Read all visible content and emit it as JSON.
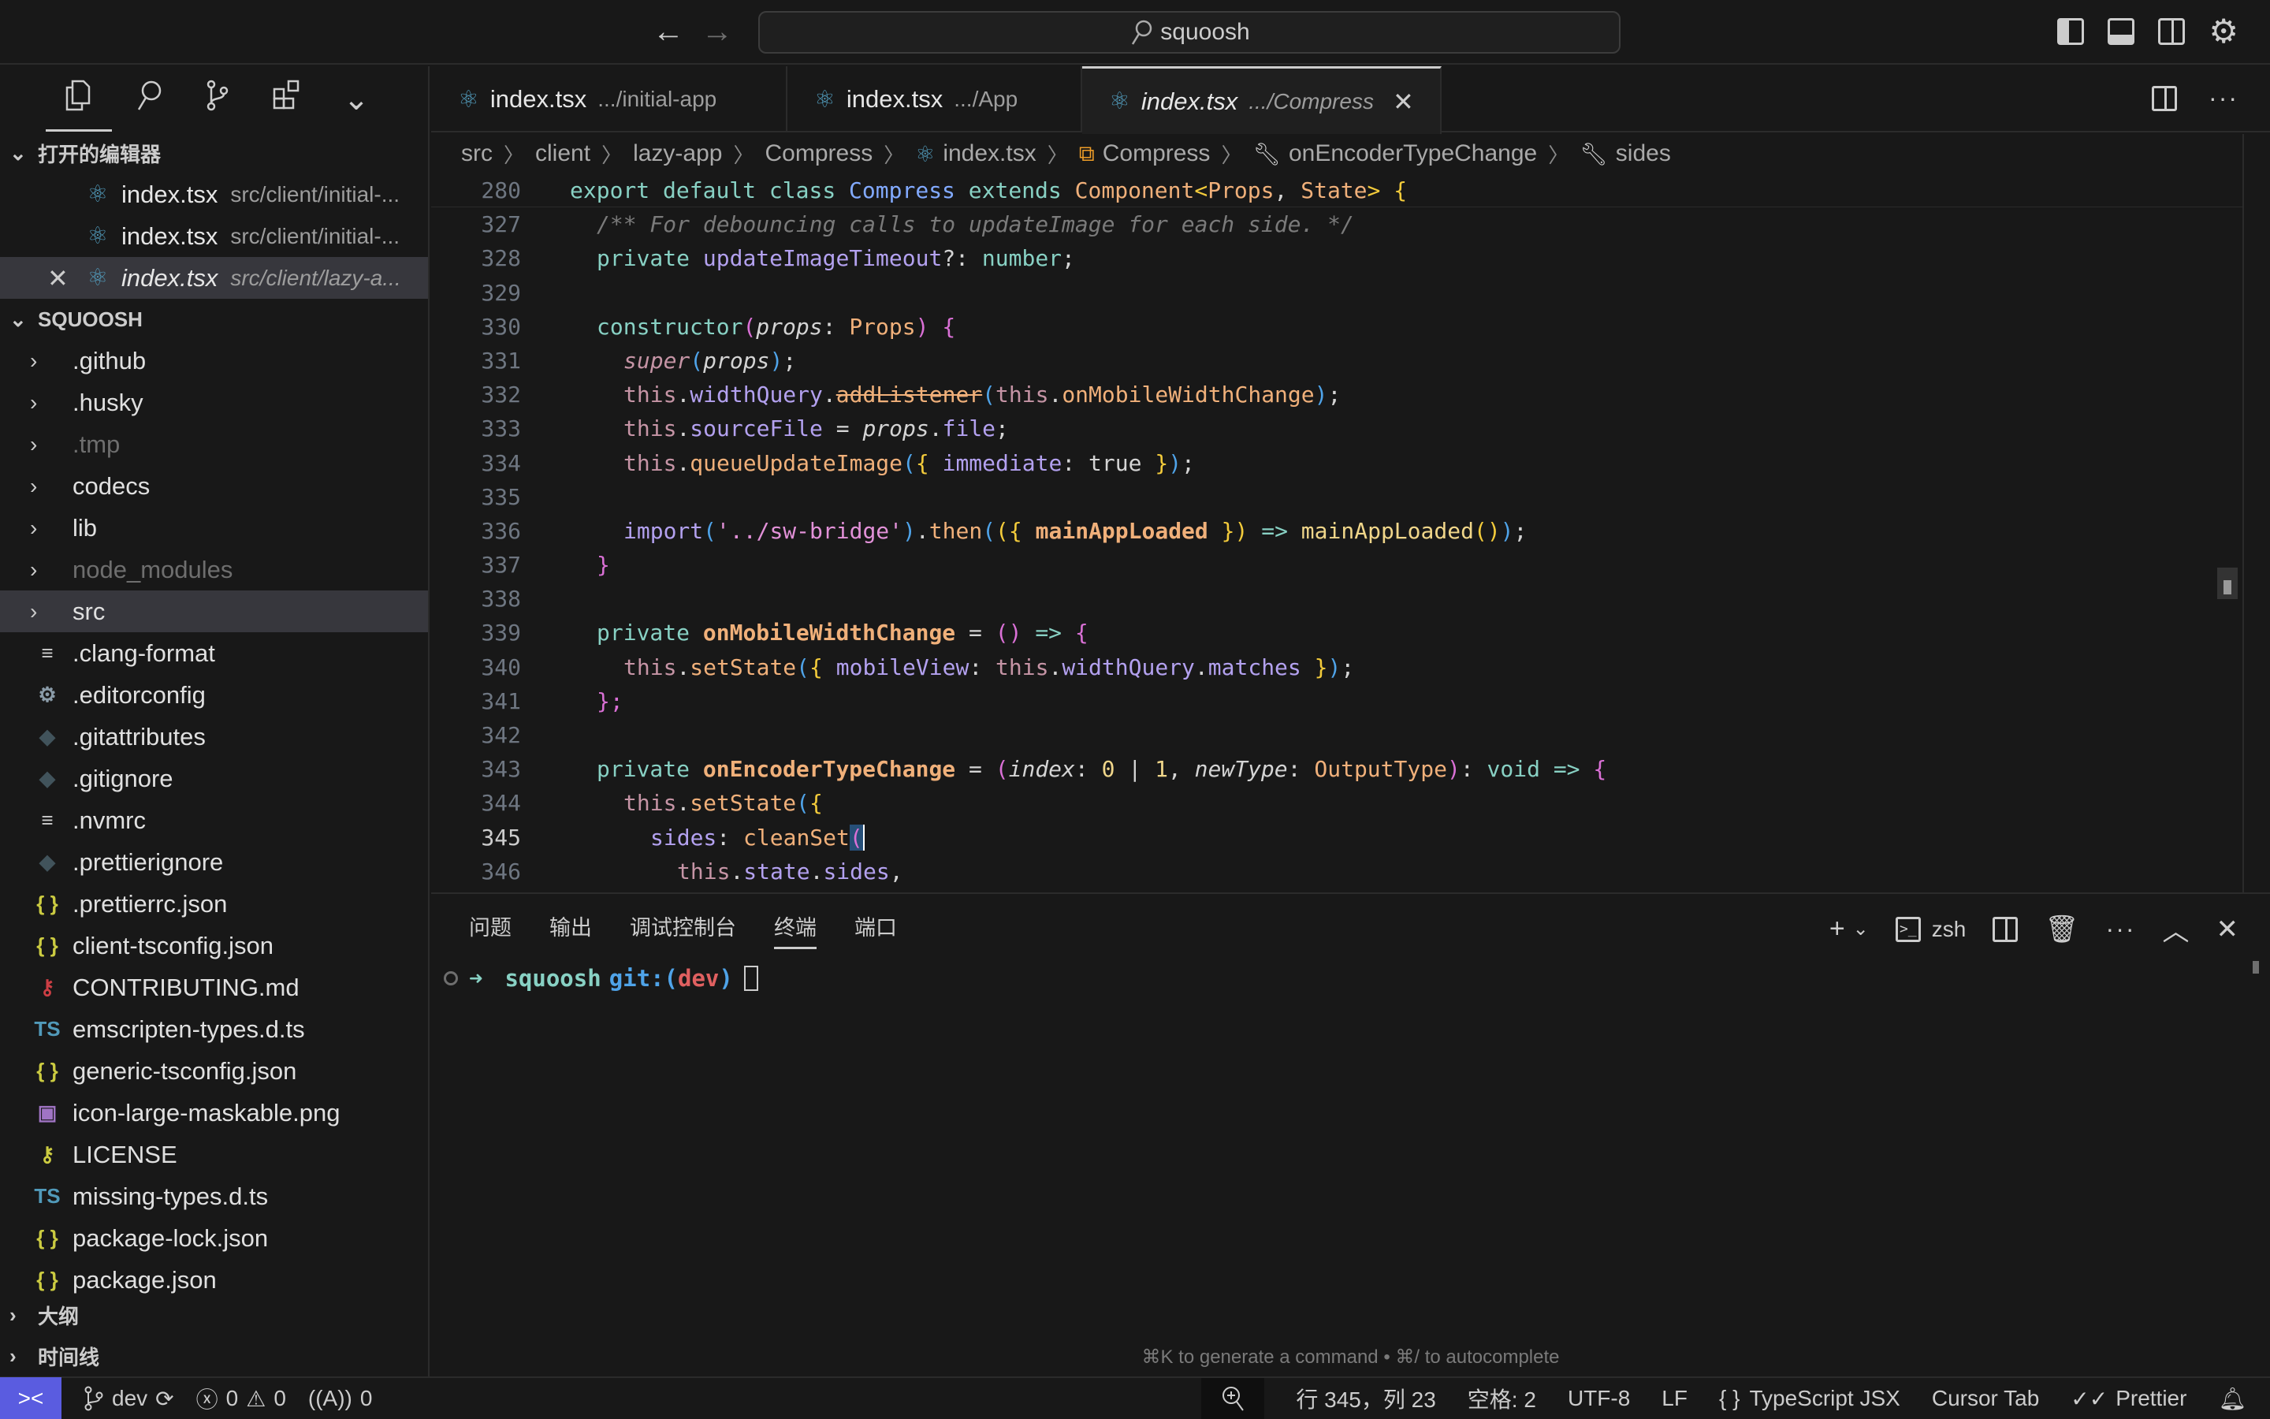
{
  "titlebar": {
    "search_text": "squoosh",
    "icons": [
      "arrow-left-icon",
      "arrow-right-icon",
      "toggle-primary-sidebar-icon",
      "toggle-panel-icon",
      "toggle-secondary-sidebar-icon",
      "settings-gear-icon"
    ]
  },
  "sidebar": {
    "activity_icons": [
      "explorer-icon",
      "search-icon",
      "source-control-icon",
      "extensions-icon",
      "chevron-down-icon"
    ],
    "open_editors_title": "打开的编辑器",
    "open_editors": [
      {
        "name": "index.tsx",
        "path": "src/client/initial-...",
        "active": false
      },
      {
        "name": "index.tsx",
        "path": "src/client/initial-...",
        "active": false
      },
      {
        "name": "index.tsx",
        "path": "src/client/lazy-a...",
        "active": true
      }
    ],
    "project_title": "SQUOOSH",
    "tree": [
      {
        "name": ".github",
        "type": "folder"
      },
      {
        "name": ".husky",
        "type": "folder"
      },
      {
        "name": ".tmp",
        "type": "folder",
        "dim": true
      },
      {
        "name": "codecs",
        "type": "folder"
      },
      {
        "name": "lib",
        "type": "folder"
      },
      {
        "name": "node_modules",
        "type": "folder",
        "dim": true
      },
      {
        "name": "src",
        "type": "folder",
        "selected": true
      },
      {
        "name": ".clang-format",
        "type": "text"
      },
      {
        "name": ".editorconfig",
        "type": "config"
      },
      {
        "name": ".gitattributes",
        "type": "git"
      },
      {
        "name": ".gitignore",
        "type": "git"
      },
      {
        "name": ".nvmrc",
        "type": "text"
      },
      {
        "name": ".prettierignore",
        "type": "git"
      },
      {
        "name": ".prettierrc.json",
        "type": "json"
      },
      {
        "name": "client-tsconfig.json",
        "type": "json"
      },
      {
        "name": "CONTRIBUTING.md",
        "type": "contrib"
      },
      {
        "name": "emscripten-types.d.ts",
        "type": "ts"
      },
      {
        "name": "generic-tsconfig.json",
        "type": "json"
      },
      {
        "name": "icon-large-maskable.png",
        "type": "image"
      },
      {
        "name": "LICENSE",
        "type": "license"
      },
      {
        "name": "missing-types.d.ts",
        "type": "ts"
      },
      {
        "name": "package-lock.json",
        "type": "json"
      },
      {
        "name": "package.json",
        "type": "json"
      }
    ],
    "outline_title": "大纲",
    "timeline_title": "时间线"
  },
  "tabs": [
    {
      "name": "index.tsx",
      "path": ".../initial-app",
      "active": false
    },
    {
      "name": "index.tsx",
      "path": ".../App",
      "active": false
    },
    {
      "name": "index.tsx",
      "path": ".../Compress",
      "active": true
    }
  ],
  "breadcrumb": [
    "src",
    "client",
    "lazy-app",
    "Compress",
    "index.tsx",
    "Compress",
    "onEncoderTypeChange",
    "sides"
  ],
  "editor": {
    "current_line": 345,
    "lines": [
      {
        "n": "280",
        "sticky": true
      },
      {
        "n": "327"
      },
      {
        "n": "328"
      },
      {
        "n": "329"
      },
      {
        "n": "330"
      },
      {
        "n": "331"
      },
      {
        "n": "332"
      },
      {
        "n": "333"
      },
      {
        "n": "334"
      },
      {
        "n": "335"
      },
      {
        "n": "336"
      },
      {
        "n": "337"
      },
      {
        "n": "338"
      },
      {
        "n": "339"
      },
      {
        "n": "340"
      },
      {
        "n": "341"
      },
      {
        "n": "342"
      },
      {
        "n": "343"
      },
      {
        "n": "344"
      },
      {
        "n": "345"
      },
      {
        "n": "346"
      }
    ],
    "code": {
      "l280": [
        "export",
        "default",
        "class",
        "Compress",
        "extends",
        "Component",
        "<",
        "Props",
        ", ",
        "State",
        ">",
        "{"
      ],
      "l327": "/** For debouncing calls to updateImage for each side. */",
      "l328": [
        "private",
        "updateImageTimeout",
        "?: ",
        "number",
        ";"
      ],
      "l330": [
        "constructor",
        "(",
        "props",
        ": ",
        "Props",
        ")",
        "{"
      ],
      "l331": [
        "super",
        "(",
        "props",
        ")",
        ";"
      ],
      "l332": [
        "this",
        ".",
        "widthQuery",
        ".",
        "addListener",
        "(",
        "this",
        ".",
        "onMobileWidthChange",
        ")",
        ";"
      ],
      "l333": [
        "this",
        ".",
        "sourceFile",
        " = ",
        "props",
        ".",
        "file",
        ";"
      ],
      "l334": [
        "this",
        ".",
        "queueUpdateImage",
        "(",
        "{",
        "immediate",
        ": ",
        "true",
        "}",
        ")",
        ";"
      ],
      "l336": [
        "import",
        "(",
        "'../sw-bridge'",
        ")",
        ".",
        "then",
        "(",
        "(",
        "{",
        "mainAppLoaded",
        "}",
        ")",
        "=>",
        "mainAppLoaded",
        "(",
        ")",
        ")",
        ";"
      ],
      "l337": "}",
      "l339": [
        "private",
        "onMobileWidthChange",
        " = ",
        "(",
        ")",
        "=>",
        "{"
      ],
      "l340": [
        "this",
        ".",
        "setState",
        "(",
        "{",
        "mobileView",
        ": ",
        "this",
        ".",
        "widthQuery",
        ".",
        "matches",
        "}",
        ")",
        ";"
      ],
      "l341": "};",
      "l343": [
        "private",
        "onEncoderTypeChange",
        " = ",
        "(",
        "index",
        ": ",
        "0",
        " | ",
        "1",
        ", ",
        "newType",
        ": ",
        "OutputType",
        ")",
        ": ",
        "void",
        "=>",
        "{"
      ],
      "l344": [
        "this",
        ".",
        "setState",
        "(",
        "{"
      ],
      "l345": [
        "sides",
        ": ",
        "cleanSet",
        "("
      ],
      "l346": [
        "this",
        ".",
        "state",
        ".",
        "sides",
        ","
      ]
    }
  },
  "panel": {
    "tabs": [
      {
        "label": "问题",
        "active": false
      },
      {
        "label": "输出",
        "active": false
      },
      {
        "label": "调试控制台",
        "active": false
      },
      {
        "label": "终端",
        "active": true
      },
      {
        "label": "端口",
        "active": false
      }
    ],
    "shell": "zsh",
    "terminal": {
      "arrow": "➜",
      "dir": "squoosh",
      "git_prefix": "git:(",
      "branch": "dev",
      "git_suffix": ")"
    },
    "hint": "⌘K to generate a command • ⌘/ to autocomplete"
  },
  "statusbar": {
    "branch": "dev",
    "errors": "0",
    "warnings": "0",
    "ports": "0",
    "position": "行 345，列 23",
    "indent": "空格: 2",
    "encoding": "UTF-8",
    "eol": "LF",
    "language": "TypeScript JSX",
    "cursor_tab": "Cursor Tab",
    "formatter": "Prettier"
  },
  "colors": {
    "accent": "#5a5ce0",
    "background": "#181818",
    "react_icon": "#519aba",
    "json_icon": "#cbcb41"
  }
}
